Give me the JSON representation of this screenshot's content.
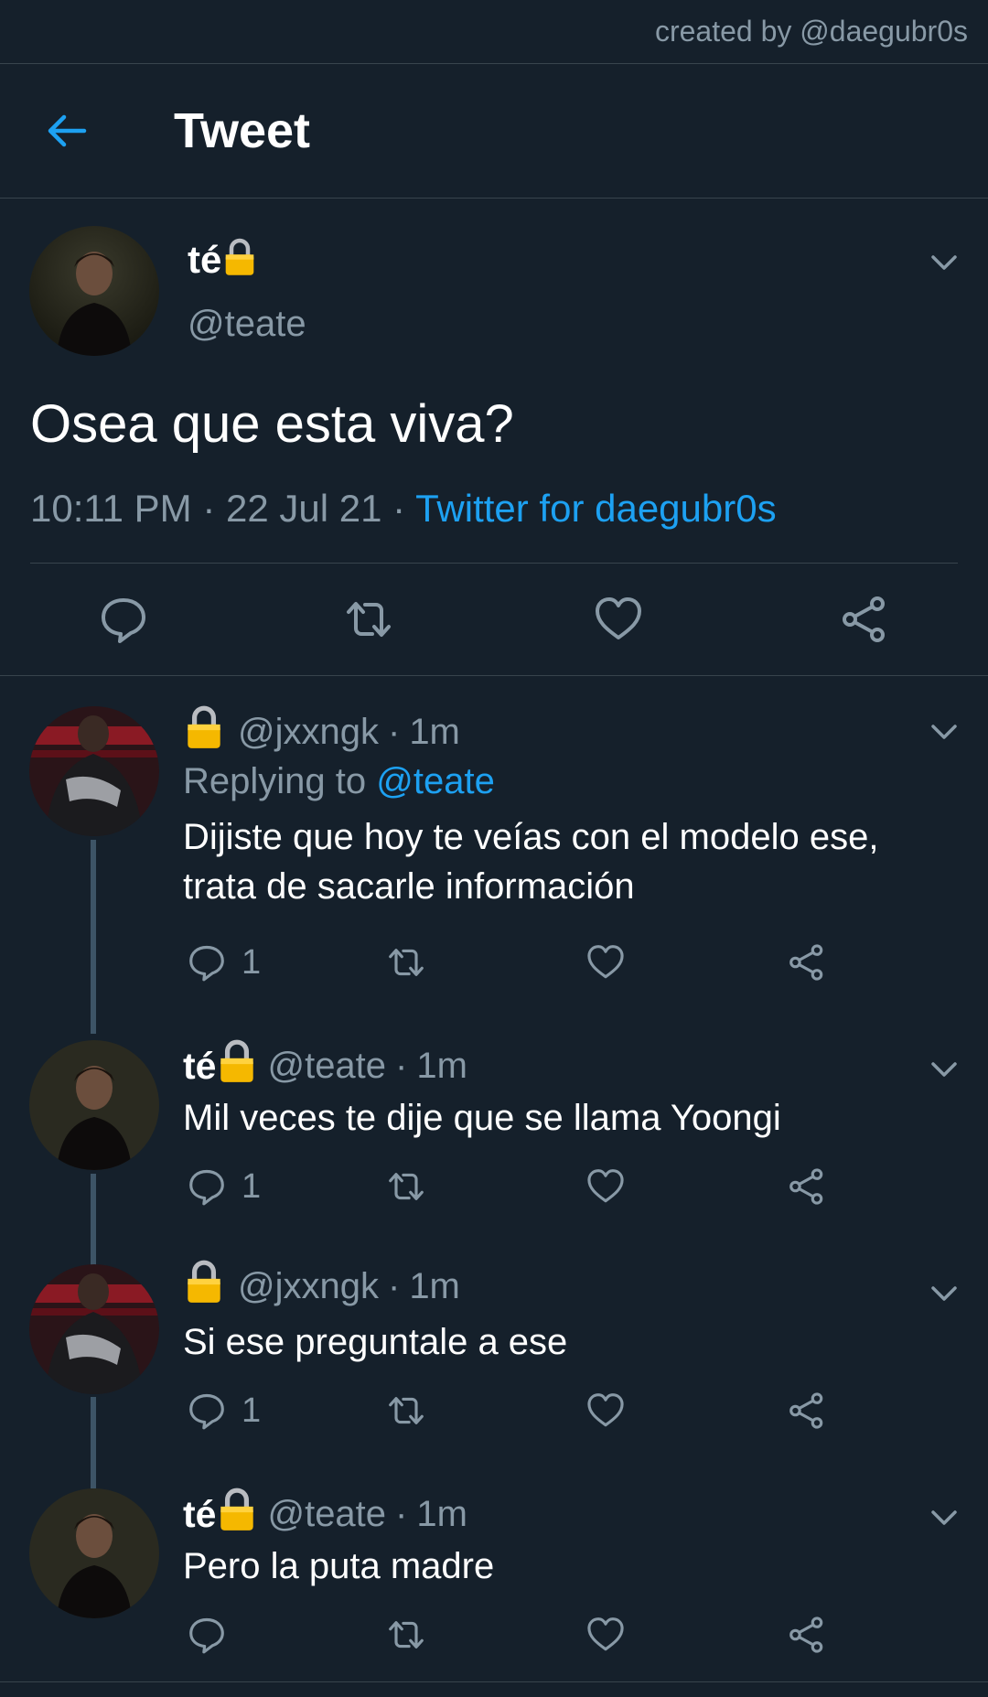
{
  "watermark": "created by @daegubr0s",
  "header": {
    "title": "Tweet"
  },
  "main_tweet": {
    "display_name": "té",
    "handle": "@teate",
    "text": "Osea que esta viva?",
    "time": "10:11 PM",
    "date": "22 Jul 21",
    "source": "Twitter for daegubr0s",
    "dot": "·"
  },
  "replies": [
    {
      "display_name": "",
      "handle": "@jxxngk",
      "time": "1m",
      "replying_prefix": "Replying to",
      "replying_to": "@teate",
      "text": "Dijiste que hoy te veías con el modelo ese, trata de sacarle información",
      "reply_count": "1"
    },
    {
      "display_name": "té",
      "handle": "@teate",
      "time": "1m",
      "text": "Mil veces te dije que se llama Yoongi",
      "reply_count": "1"
    },
    {
      "display_name": "",
      "handle": "@jxxngk",
      "time": "1m",
      "text": "Si ese preguntale a ese",
      "reply_count": "1"
    },
    {
      "display_name": "té",
      "handle": "@teate",
      "time": "1m",
      "text": "Pero la puta madre",
      "reply_count": ""
    }
  ],
  "colors": {
    "background": "#15202b",
    "accent": "#1da1f2",
    "muted": "#8899a6",
    "divider": "#38444d",
    "lock": "#f5b800"
  },
  "icons": [
    "back-arrow-icon",
    "chevron-down-icon",
    "lock-icon",
    "reply-icon",
    "retweet-icon",
    "like-icon",
    "share-icon"
  ]
}
